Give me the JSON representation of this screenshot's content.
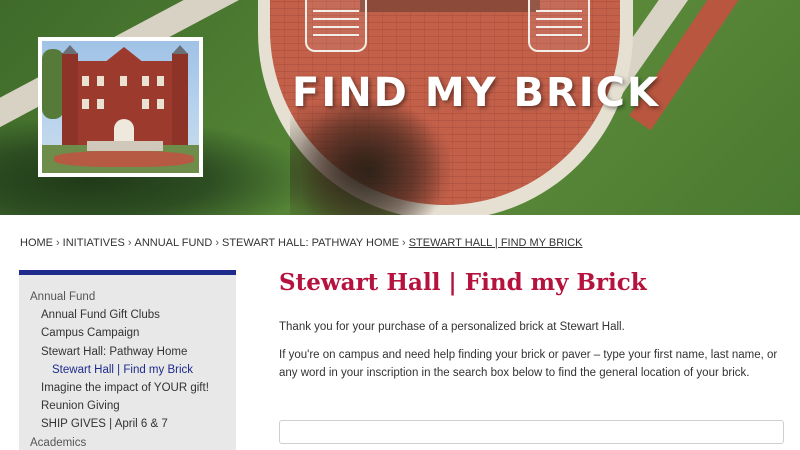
{
  "hero": {
    "title": "FIND MY BRICK",
    "photo_alt": "Stewart Hall building"
  },
  "breadcrumb": [
    {
      "label": "HOME"
    },
    {
      "label": "INITIATIVES"
    },
    {
      "label": "ANNUAL FUND"
    },
    {
      "label": "STEWART HALL: PATHWAY HOME"
    },
    {
      "label": "STEWART HALL | FIND MY BRICK"
    }
  ],
  "breadcrumb_separator": "›",
  "sidebar": {
    "accent_color": "#1e2b8c",
    "items": [
      {
        "label": "Annual Fund",
        "level": 0
      },
      {
        "label": "Annual Fund Gift Clubs",
        "level": 1
      },
      {
        "label": "Campus Campaign",
        "level": 1
      },
      {
        "label": "Stewart Hall: Pathway Home",
        "level": 1
      },
      {
        "label": "Stewart Hall | Find my Brick",
        "level": 2,
        "active": true
      },
      {
        "label": "Imagine the impact of YOUR gift!",
        "level": 1
      },
      {
        "label": "Reunion Giving",
        "level": 1
      },
      {
        "label": "SHIP GIVES | April 6 & 7",
        "level": 1
      },
      {
        "label": "Academics",
        "level": 0
      }
    ]
  },
  "main": {
    "title": "Stewart Hall | Find my Brick",
    "title_color": "#b5123e",
    "paragraph1": "Thank you for your purchase of a personalized brick at Stewart Hall.",
    "paragraph2": "If you're on campus and need help finding your brick or paver – type your first name, last name, or any word in your inscription in the search box below to find the general location of your brick.",
    "search": {
      "value": "",
      "placeholder": ""
    }
  }
}
